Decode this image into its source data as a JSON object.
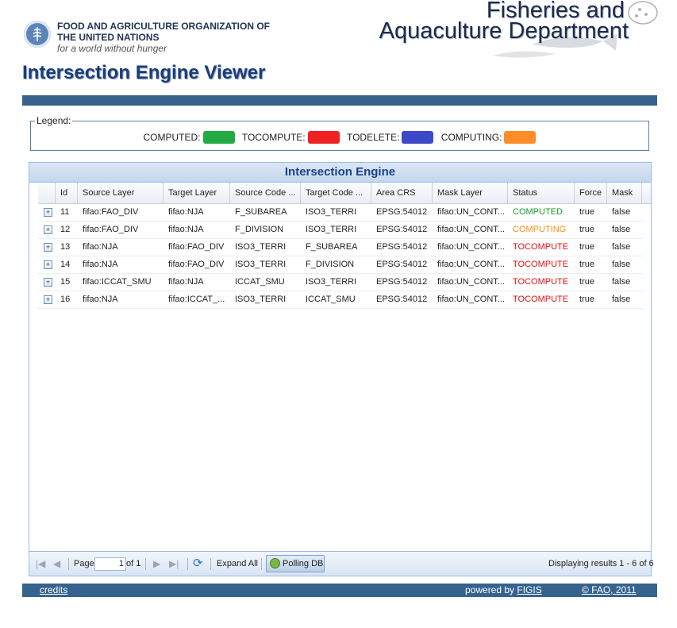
{
  "header": {
    "org_line1": "FOOD AND AGRICULTURE ORGANIZATION OF",
    "org_line2": "THE UNITED NATIONS",
    "motto": "for a world without hunger",
    "dept_line1": "Fisheries and",
    "dept_line2": "Aquaculture Department",
    "logo_icon": "fao-logo-icon",
    "art_icon": "fish-illustration"
  },
  "page_title": "Intersection Engine Viewer",
  "legend": {
    "title": "Legend:",
    "items": [
      {
        "label": "COMPUTED:",
        "color": "#22aa44"
      },
      {
        "label": "TOCOMPUTE:",
        "color": "#ee2222"
      },
      {
        "label": "TODELETE:",
        "color": "#3d48c8"
      },
      {
        "label": "COMPUTING:",
        "color": "#ff8c2a"
      }
    ]
  },
  "grid": {
    "title": "Intersection Engine",
    "columns": [
      "Id",
      "Source Layer",
      "Target Layer",
      "Source Code ...",
      "Target Code ...",
      "Area CRS",
      "Mask Layer",
      "Status",
      "Force",
      "Mask"
    ],
    "rows": [
      {
        "id": "11",
        "source_layer": "fifao:FAO_DIV",
        "target_layer": "fifao:NJA",
        "source_code": "F_SUBAREA",
        "target_code": "ISO3_TERRI",
        "area_crs": "EPSG:54012",
        "mask_layer": "fifao:UN_CONT...",
        "status": "COMPUTED",
        "force": "true",
        "mask": "false"
      },
      {
        "id": "12",
        "source_layer": "fifao:FAO_DIV",
        "target_layer": "fifao:NJA",
        "source_code": "F_DIVISION",
        "target_code": "ISO3_TERRI",
        "area_crs": "EPSG:54012",
        "mask_layer": "fifao:UN_CONT...",
        "status": "COMPUTING",
        "force": "true",
        "mask": "false"
      },
      {
        "id": "13",
        "source_layer": "fifao:NJA",
        "target_layer": "fifao:FAO_DIV",
        "source_code": "ISO3_TERRI",
        "target_code": "F_SUBAREA",
        "area_crs": "EPSG:54012",
        "mask_layer": "fifao:UN_CONT...",
        "status": "TOCOMPUTE",
        "force": "true",
        "mask": "false"
      },
      {
        "id": "14",
        "source_layer": "fifao:NJA",
        "target_layer": "fifao:FAO_DIV",
        "source_code": "ISO3_TERRI",
        "target_code": "F_DIVISION",
        "area_crs": "EPSG:54012",
        "mask_layer": "fifao:UN_CONT...",
        "status": "TOCOMPUTE",
        "force": "true",
        "mask": "false"
      },
      {
        "id": "15",
        "source_layer": "fifao:ICCAT_SMU",
        "target_layer": "fifao:NJA",
        "source_code": "ICCAT_SMU",
        "target_code": "ISO3_TERRI",
        "area_crs": "EPSG:54012",
        "mask_layer": "fifao:UN_CONT...",
        "status": "TOCOMPUTE",
        "force": "true",
        "mask": "false"
      },
      {
        "id": "16",
        "source_layer": "fifao:NJA",
        "target_layer": "fifao:ICCAT_...",
        "source_code": "ISO3_TERRI",
        "target_code": "ICCAT_SMU",
        "area_crs": "EPSG:54012",
        "mask_layer": "fifao:UN_CONT...",
        "status": "TOCOMPUTE",
        "force": "true",
        "mask": "false"
      }
    ],
    "status_colors": {
      "COMPUTED": "#1a9a2a",
      "COMPUTING": "#f0901a",
      "TOCOMPUTE": "#e01010",
      "TODELETE": "#3d48c8"
    }
  },
  "toolbar": {
    "page_label": "Page",
    "page_value": "1",
    "of_label": "of 1",
    "expand_all": "Expand All",
    "polling_db": "Polling DB",
    "display_msg": "Displaying results 1 - 6 of 6",
    "icons": [
      "first-page-icon",
      "prev-page-icon",
      "next-page-icon",
      "last-page-icon",
      "refresh-icon",
      "polling-icon"
    ]
  },
  "footer": {
    "credits": "credits",
    "powered_by": "powered by ",
    "figis": "FIGIS",
    "copyright": "© FAO, 2011"
  }
}
